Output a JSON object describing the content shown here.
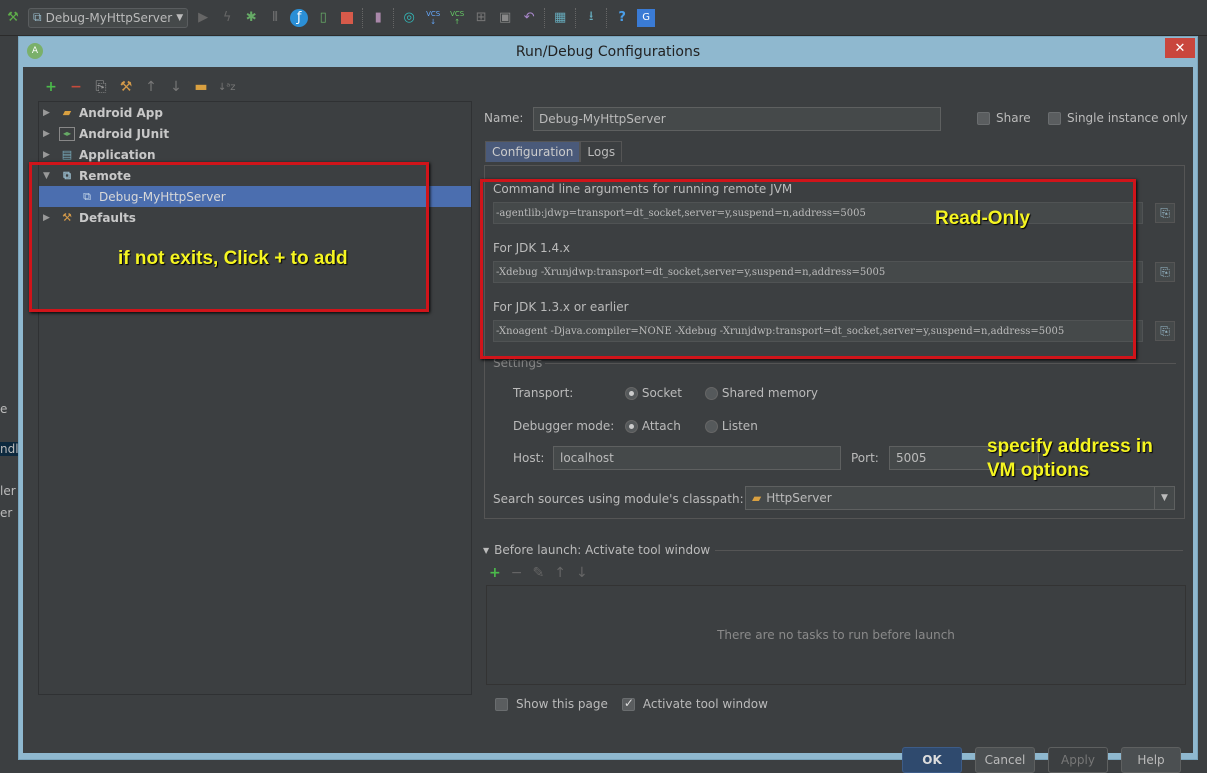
{
  "toolbar": {
    "run_config": "Debug-MyHttpServer",
    "icons": [
      "make-icon",
      "run-config-icon",
      "run-icon",
      "lightning-icon",
      "debug-icon",
      "coverage-icon",
      "profile-icon",
      "device-icon",
      "stop-icon",
      "avd-manager-icon",
      "sync-icon",
      "vcs-update-icon",
      "vcs-commit-icon",
      "vcs-compare-icon",
      "vcs-history-icon",
      "revert-icon",
      "project-structure-icon",
      "sdk-manager-icon",
      "help-icon",
      "translate-icon"
    ],
    "vcs_label": "VCS"
  },
  "ide_left": {
    "fragments": [
      "e",
      "ndl",
      "ler",
      "er"
    ]
  },
  "dialog": {
    "title": "Run/Debug Configurations",
    "close_label": "✕",
    "left_toolbar": {
      "add": "+",
      "remove": "−",
      "copy": "⎘",
      "edit_defaults": "⚒",
      "up": "↑",
      "down": "↓",
      "folder": "▬",
      "sort": "↓ᵃz"
    },
    "tree": [
      {
        "label": "Android App",
        "expanded": false,
        "icon": "android-app-icon"
      },
      {
        "label": "Android JUnit",
        "expanded": false,
        "icon": "android-junit-icon"
      },
      {
        "label": "Application",
        "expanded": false,
        "icon": "application-icon"
      },
      {
        "label": "Remote",
        "expanded": true,
        "icon": "remote-icon"
      },
      {
        "label": "Debug-MyHttpServer",
        "selected": true,
        "icon": "remote-icon"
      },
      {
        "label": "Defaults",
        "expanded": false,
        "icon": "defaults-icon"
      }
    ],
    "name_label": "Name:",
    "name_value": "Debug-MyHttpServer",
    "share_label": "Share",
    "single_instance_label": "Single instance only",
    "tabs": [
      "Configuration",
      "Logs"
    ],
    "config": {
      "cmd_label": "Command line arguments for running remote JVM",
      "cmd_value": "-agentlib:jdwp=transport=dt_socket,server=y,suspend=n,address=5005",
      "jdk14_label": "For JDK 1.4.x",
      "jdk14_value": "-Xdebug -Xrunjdwp:transport=dt_socket,server=y,suspend=n,address=5005",
      "jdk13_label": "For JDK 1.3.x or earlier",
      "jdk13_value": "-Xnoagent -Djava.compiler=NONE -Xdebug -Xrunjdwp:transport=dt_socket,server=y,suspend=n,address=5005",
      "settings_label": "Settings",
      "transport_label": "Transport:",
      "transport_options": [
        "Socket",
        "Shared memory"
      ],
      "transport_selected": "Socket",
      "debugger_mode_label": "Debugger mode:",
      "debugger_mode_options": [
        "Attach",
        "Listen"
      ],
      "debugger_mode_selected": "Attach",
      "host_label": "Host:",
      "host_value": "localhost",
      "port_label": "Port:",
      "port_value": "5005",
      "classpath_label": "Search sources using module's classpath:",
      "classpath_value": "HttpServer"
    },
    "before_launch": {
      "title": "Before launch: Activate tool window",
      "tools": {
        "add": "+",
        "remove": "−",
        "edit": "✎",
        "up": "↑",
        "down": "↓"
      },
      "empty_text": "There are no tasks to run before launch",
      "show_page_label": "Show this page",
      "show_page_checked": false,
      "activate_label": "Activate tool window",
      "activate_checked": true
    },
    "buttons": {
      "ok": "OK",
      "cancel": "Cancel",
      "apply": "Apply",
      "help": "Help"
    }
  },
  "annotations": {
    "left": "if not exits, Click + to add",
    "readonly": "Read-Only",
    "address_line1": "specify address in",
    "address_line2": "VM options"
  },
  "colors": {
    "selection": "#4b6eaf",
    "annotation_border": "#d0141a",
    "annotation_text": "#f5f521",
    "close": "#c9463d",
    "ok_button": "#2f4a6e"
  }
}
